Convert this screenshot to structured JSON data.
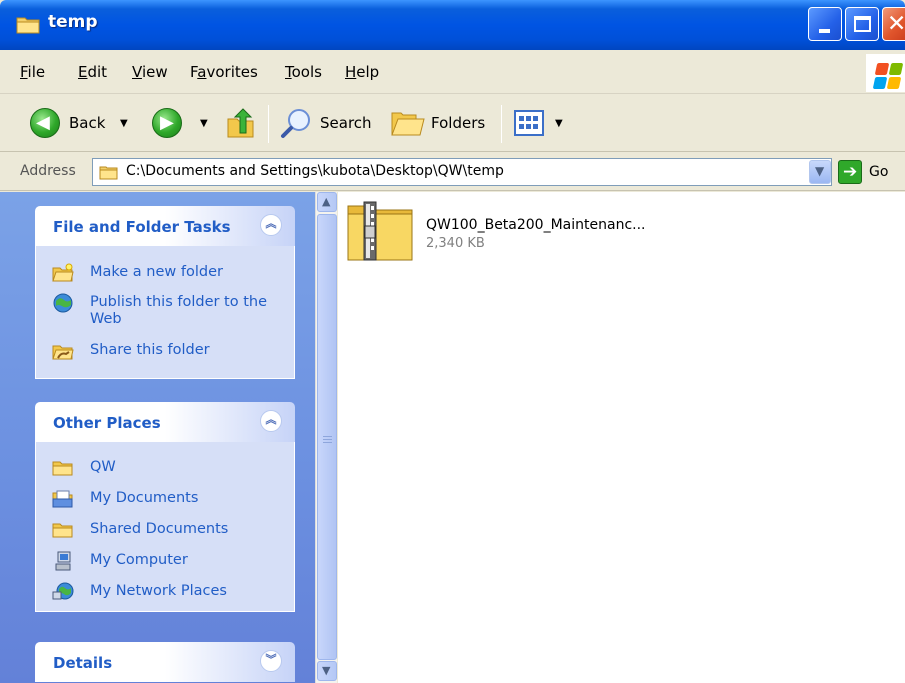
{
  "window": {
    "title": "temp"
  },
  "menu": {
    "items": [
      {
        "label": "File",
        "underline": "F",
        "rest": "ile"
      },
      {
        "label": "Edit",
        "underline": "E",
        "rest": "dit"
      },
      {
        "label": "View",
        "underline": "V",
        "rest": "iew"
      },
      {
        "label": "Favorites",
        "underline": "a",
        "pre": "F",
        "rest": "vorites"
      },
      {
        "label": "Tools",
        "underline": "T",
        "rest": "ools"
      },
      {
        "label": "Help",
        "underline": "H",
        "rest": "elp"
      }
    ]
  },
  "toolbar": {
    "back_label": "Back",
    "search_label": "Search",
    "folders_label": "Folders"
  },
  "address": {
    "label": "Address",
    "value": "C:\\Documents and Settings\\kubota\\Desktop\\QW\\temp",
    "go_label": "Go"
  },
  "tasks_panel": {
    "title": "File and Folder Tasks",
    "items": [
      {
        "label": "Make a new folder",
        "icon": "new-folder-icon"
      },
      {
        "label": "Publish this folder to the Web",
        "icon": "publish-web-icon"
      },
      {
        "label": "Share this folder",
        "icon": "share-folder-icon"
      }
    ]
  },
  "places_panel": {
    "title": "Other Places",
    "items": [
      {
        "label": "QW",
        "icon": "folder-icon"
      },
      {
        "label": "My Documents",
        "icon": "my-documents-icon"
      },
      {
        "label": "Shared Documents",
        "icon": "folder-icon"
      },
      {
        "label": "My Computer",
        "icon": "my-computer-icon"
      },
      {
        "label": "My Network Places",
        "icon": "network-places-icon"
      }
    ]
  },
  "details_panel": {
    "title": "Details"
  },
  "files": [
    {
      "name": "QW100_Beta200_Maintenanc...",
      "size": "2,340 KB",
      "icon": "zip-folder-icon"
    }
  ],
  "colors": {
    "title_bar": "#0054e3",
    "task_link": "#215dc6",
    "left_pane": "#6b8fe0",
    "panel_body": "#d6dff7"
  }
}
